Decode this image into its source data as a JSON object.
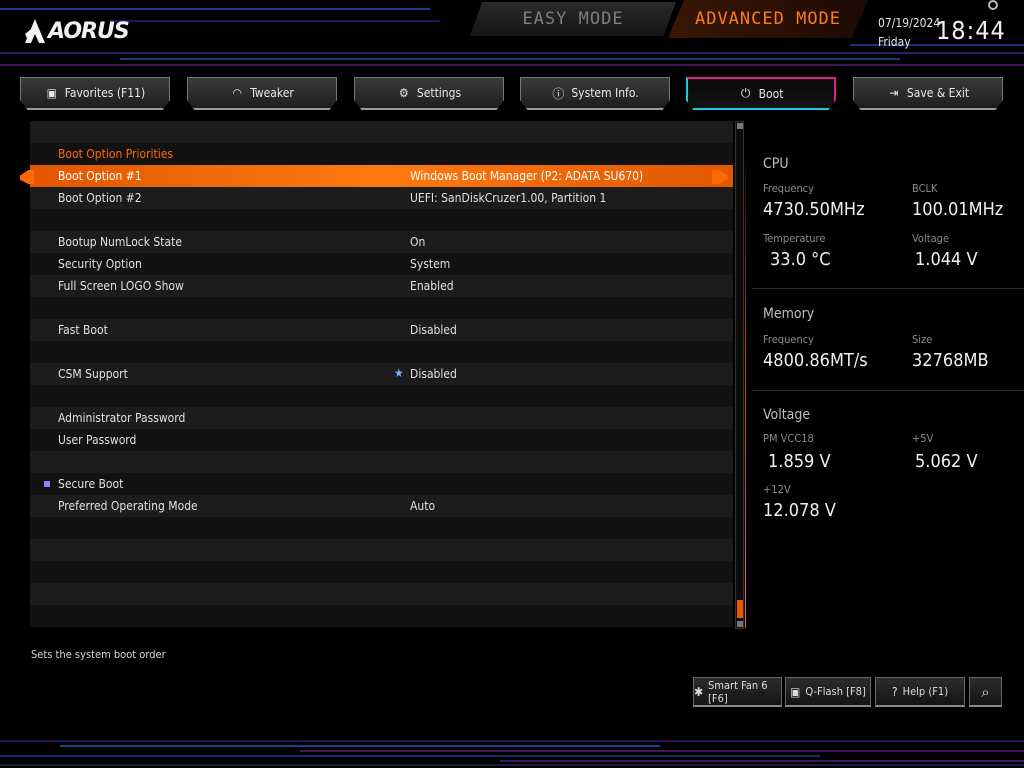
{
  "header": {
    "logo_text": "AORUS",
    "easy_mode": "EASY MODE",
    "advanced_mode": "ADVANCED MODE",
    "date": "07/19/2024",
    "day": "Friday",
    "time": "18:44"
  },
  "tabs": [
    {
      "label": "Favorites (F11)",
      "icon": "favorites-icon"
    },
    {
      "label": "Tweaker",
      "icon": "gauge-icon"
    },
    {
      "label": "Settings",
      "icon": "gear-icon"
    },
    {
      "label": "System Info.",
      "icon": "info-icon"
    },
    {
      "label": "Boot",
      "icon": "power-icon",
      "active": true
    },
    {
      "label": "Save & Exit",
      "icon": "exit-icon"
    }
  ],
  "boot": {
    "section_title": "Boot Option Priorities",
    "rows": [
      {
        "label": "Boot Option #1",
        "value": "Windows Boot Manager (P2: ADATA SU670)"
      },
      {
        "label": "Boot Option #2",
        "value": "UEFI: SanDiskCruzer1.00, Partition 1"
      },
      {
        "label": "Bootup NumLock State",
        "value": "On"
      },
      {
        "label": "Security Option",
        "value": "System"
      },
      {
        "label": "Full Screen LOGO Show",
        "value": "Enabled"
      },
      {
        "label": "Fast Boot",
        "value": "Disabled"
      },
      {
        "label": "CSM Support",
        "value": "Disabled"
      },
      {
        "label": "Administrator Password",
        "value": ""
      },
      {
        "label": "User Password",
        "value": ""
      },
      {
        "label": "Secure Boot",
        "value": ""
      },
      {
        "label": "Preferred Operating Mode",
        "value": "Auto"
      }
    ]
  },
  "hw": {
    "cpu": {
      "title": "CPU",
      "freq_label": "Frequency",
      "freq": "4730.50MHz",
      "bclk_label": "BCLK",
      "bclk": "100.01MHz",
      "temp_label": "Temperature",
      "temp": "33.0 °C",
      "volt_label": "Voltage",
      "volt": "1.044 V"
    },
    "memory": {
      "title": "Memory",
      "freq_label": "Frequency",
      "freq": "4800.86MT/s",
      "size_label": "Size",
      "size": "32768MB"
    },
    "voltage": {
      "title": "Voltage",
      "pm_label": "PM VCC18",
      "pm": "1.859 V",
      "p5_label": "+5V",
      "p5": "5.062 V",
      "p12_label": "+12V",
      "p12": "12.078 V"
    }
  },
  "status_text": "Sets the system boot order",
  "bottom": {
    "smart_fan": "Smart Fan 6 [F6]",
    "qflash": "Q-Flash [F8]",
    "help": "Help (F1)"
  },
  "colors": {
    "accent": "#ff6a00",
    "active_tab_pink": "#e0208a",
    "active_tab_cyan": "#20c8e0"
  }
}
